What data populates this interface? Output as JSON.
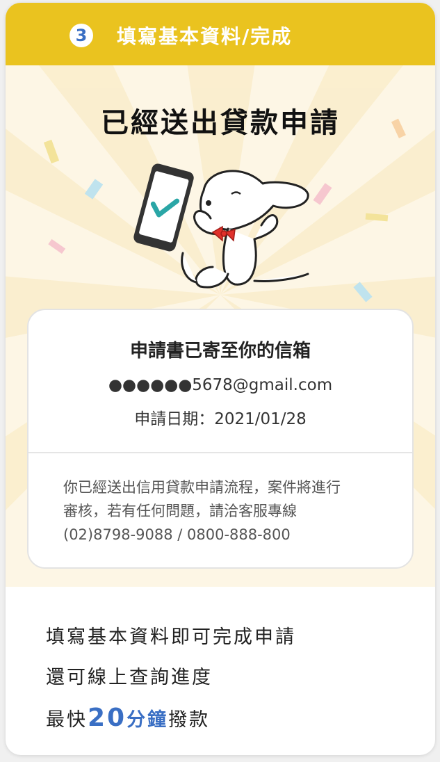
{
  "header": {
    "step_number": "3",
    "step_title": "填寫基本資料/完成"
  },
  "hero": {
    "title": "已經送出貸款申請"
  },
  "info": {
    "title": "申請書已寄至你的信箱",
    "email": "●●●●●●5678@gmail.com",
    "date": "申請日期：2021/01/28",
    "note_lines": [
      "你已經送出信用貸款申請流程，案件將進行",
      "審核，若有任何問題，請洽客服專線",
      "(02)8798-9088 / 0800-888-800"
    ]
  },
  "footer": {
    "line1": "填寫基本資料即可完成申請",
    "line2": "還可線上查詢進度",
    "line3_prefix": "最快",
    "line3_number": "20",
    "line3_highlight": "分鐘",
    "line3_suffix": "撥款"
  },
  "colors": {
    "header_bg": "#eac31f",
    "accent_blue": "#3a6fc4",
    "hero_bg": "#fdf6e5",
    "check_teal": "#2aa6a6",
    "bowtie_red": "#e0312b"
  }
}
